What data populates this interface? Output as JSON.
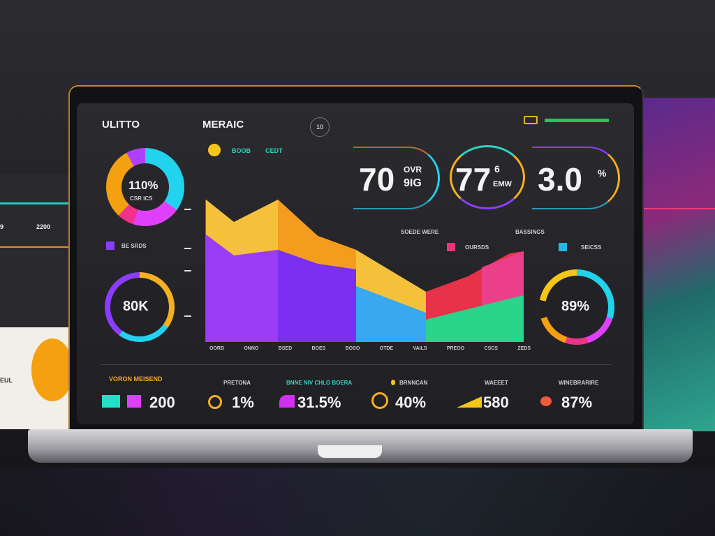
{
  "header": {
    "brand": "ULITTO",
    "title": "MERAIC",
    "badge": "10"
  },
  "legend_top": [
    "BOOB",
    "CEDT"
  ],
  "left_donut": {
    "value": "110%",
    "sub": "CSR ICS"
  },
  "left_legend": "BE SRDS",
  "left_ring": {
    "value": "80K"
  },
  "kpis": [
    {
      "value": "70",
      "sup": "OVR",
      "sub": "9IG"
    },
    {
      "value": "77",
      "sup": "6",
      "sub": "EMW"
    },
    {
      "value": "3.0",
      "sup": "%"
    }
  ],
  "chart_labels": {
    "a": "SOEDE WERE",
    "b": "BASSINGS",
    "legend1": "OURSDS",
    "legend2": "SEICSS"
  },
  "x_ticks": [
    "OORD",
    "ONNO",
    "BSED",
    "BOES",
    "BOSO",
    "OTDE",
    "VAILS",
    "PREOO",
    "CSCS",
    "ZEDS"
  ],
  "right_ring": {
    "value": "89%"
  },
  "side_panel": {
    "left_value": "2200",
    "left_partial": "9",
    "left_bottom": "EUL"
  },
  "footer": [
    {
      "label": "VORON MEISEND",
      "value": "200"
    },
    {
      "label": "PRETONA",
      "value": "1%"
    },
    {
      "label": "BNNE NIV CHLO BOERA",
      "value": "31.5%"
    },
    {
      "label": "BRNNCAN",
      "value": "40%"
    },
    {
      "label": "WAEEET",
      "value": "580"
    },
    {
      "label": "WINEBRARIRE",
      "value": "87%"
    }
  ],
  "colors": {
    "accent_orange": "#f5a623",
    "cyan": "#22d3ee",
    "magenta": "#e040fb",
    "purple": "#8b3dff",
    "green": "#22c55e",
    "red": "#ef4444"
  }
}
